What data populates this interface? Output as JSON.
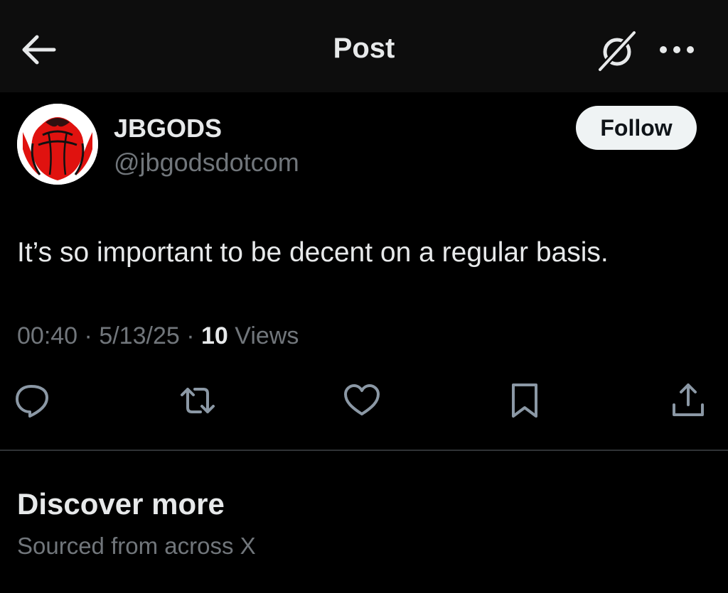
{
  "header": {
    "title": "Post",
    "back_icon": "arrow-left-icon",
    "grok_icon": "grok-icon",
    "more_icon": "more-horizontal-icon"
  },
  "author": {
    "display_name": "JBGODS",
    "handle": "@jbgodsdotcom",
    "avatar_icon": "red-rose-avatar",
    "follow_label": "Follow"
  },
  "post": {
    "text": "It’s so important to be decent on a regular basis.",
    "time": "00:40",
    "date": "5/13/25",
    "views_count": "10",
    "views_label": "Views",
    "separator": "·"
  },
  "actions": [
    {
      "name": "reply",
      "icon": "reply-bubble-icon"
    },
    {
      "name": "repost",
      "icon": "repost-icon"
    },
    {
      "name": "like",
      "icon": "heart-icon"
    },
    {
      "name": "bookmark",
      "icon": "bookmark-icon"
    },
    {
      "name": "share",
      "icon": "share-icon"
    }
  ],
  "discover": {
    "title": "Discover more",
    "subtitle": "Sourced from across X"
  },
  "colors": {
    "background": "#000000",
    "header_background": "#0d0d0d",
    "text_primary": "#e7e9ea",
    "text_secondary": "#71767b",
    "icon_gray": "#8b98a5",
    "divider": "#2f3336",
    "follow_button": "#eff3f4",
    "avatar_rose": "#e0120f"
  }
}
